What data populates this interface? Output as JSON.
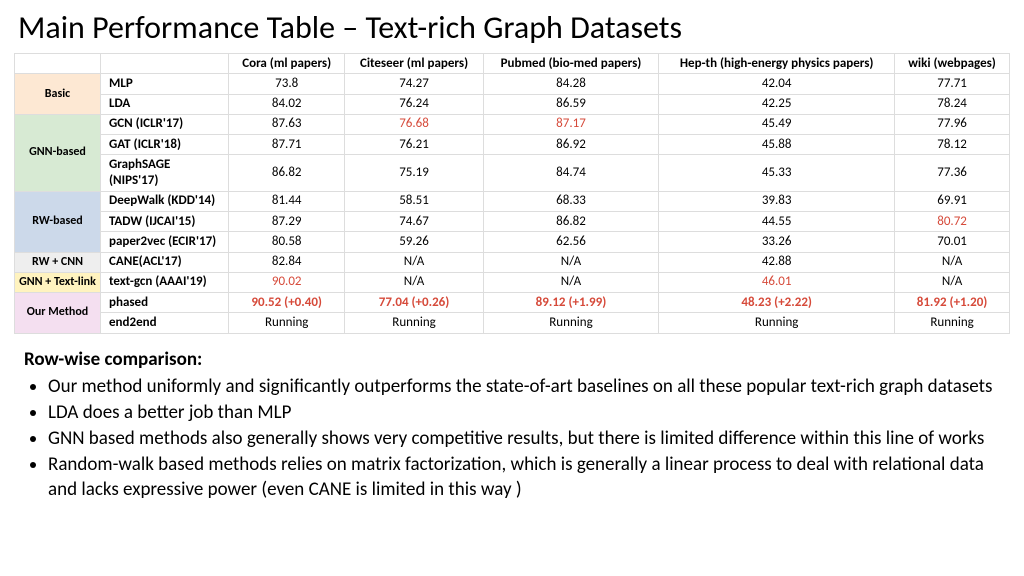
{
  "title": "Main Performance Table – Text-rich Graph Datasets",
  "columns": [
    "Cora (ml papers)",
    "Citeseer (ml papers)",
    "Pubmed (bio-med papers)",
    "Hep-th (high-energy physics papers)",
    "wiki (webpages)"
  ],
  "groups": [
    {
      "label": "Basic",
      "cls": "bg-basic",
      "rows": [
        {
          "method": "MLP",
          "cells": [
            {
              "v": "73.8"
            },
            {
              "v": "74.27"
            },
            {
              "v": "84.28"
            },
            {
              "v": "42.04"
            },
            {
              "v": "77.71"
            }
          ]
        },
        {
          "method": "LDA",
          "cells": [
            {
              "v": "84.02"
            },
            {
              "v": "76.24"
            },
            {
              "v": "86.59"
            },
            {
              "v": "42.25"
            },
            {
              "v": "78.24"
            }
          ]
        }
      ]
    },
    {
      "label": "GNN-based",
      "cls": "bg-gnn",
      "rows": [
        {
          "method": "GCN  (ICLR'17)",
          "cells": [
            {
              "v": "87.63"
            },
            {
              "v": "76.68",
              "hl": true
            },
            {
              "v": "87.17",
              "hl": true
            },
            {
              "v": "45.49"
            },
            {
              "v": "77.96"
            }
          ]
        },
        {
          "method": "GAT (ICLR'18)",
          "cells": [
            {
              "v": "87.71"
            },
            {
              "v": "76.21"
            },
            {
              "v": "86.92"
            },
            {
              "v": "45.88"
            },
            {
              "v": "78.12"
            }
          ]
        },
        {
          "method": "GraphSAGE (NIPS'17)",
          "cells": [
            {
              "v": "86.82"
            },
            {
              "v": "75.19"
            },
            {
              "v": "84.74"
            },
            {
              "v": "45.33"
            },
            {
              "v": "77.36"
            }
          ]
        }
      ]
    },
    {
      "label": "RW-based",
      "cls": "bg-rw",
      "rows": [
        {
          "method": "DeepWalk (KDD'14)",
          "cells": [
            {
              "v": "81.44"
            },
            {
              "v": "58.51"
            },
            {
              "v": "68.33"
            },
            {
              "v": "39.83"
            },
            {
              "v": "69.91"
            }
          ]
        },
        {
          "method": "TADW (IJCAI'15)",
          "cells": [
            {
              "v": "87.29"
            },
            {
              "v": "74.67"
            },
            {
              "v": "86.82"
            },
            {
              "v": "44.55"
            },
            {
              "v": "80.72",
              "hl": true
            }
          ]
        },
        {
          "method": "paper2vec (ECIR'17)",
          "cells": [
            {
              "v": "80.58"
            },
            {
              "v": "59.26"
            },
            {
              "v": "62.56"
            },
            {
              "v": "33.26"
            },
            {
              "v": "70.01"
            }
          ]
        }
      ]
    },
    {
      "label": "RW + CNN",
      "cls": "bg-rwcnn",
      "rows": [
        {
          "method": "CANE(ACL'17)",
          "cells": [
            {
              "v": "82.84"
            },
            {
              "v": "N/A"
            },
            {
              "v": "N/A"
            },
            {
              "v": "42.88"
            },
            {
              "v": "N/A"
            }
          ]
        }
      ]
    },
    {
      "label": "GNN + Text-link",
      "cls": "bg-gnnlink",
      "rows": [
        {
          "method": "text-gcn (AAAI'19)",
          "cells": [
            {
              "v": "90.02",
              "hl": true
            },
            {
              "v": "N/A"
            },
            {
              "v": "N/A"
            },
            {
              "v": "46.01",
              "hl": true
            },
            {
              "v": "N/A"
            }
          ]
        }
      ]
    },
    {
      "label": "Our Method",
      "cls": "bg-our",
      "rows": [
        {
          "method": "phased",
          "cells": [
            {
              "v": "90.52  (+0.40)",
              "hlb": true
            },
            {
              "v": "77.04 (+0.26)",
              "hlb": true
            },
            {
              "v": "89.12 (+1.99)",
              "hlb": true
            },
            {
              "v": "48.23 (+2.22)",
              "hlb": true
            },
            {
              "v": "81.92 (+1.20)",
              "hlb": true
            }
          ]
        },
        {
          "method": "end2end",
          "cells": [
            {
              "v": "Running"
            },
            {
              "v": "Running"
            },
            {
              "v": "Running"
            },
            {
              "v": "Running"
            },
            {
              "v": "Running"
            }
          ]
        }
      ]
    }
  ],
  "comparison": {
    "heading": "Row-wise comparison:",
    "bullets": [
      "Our method uniformly and significantly outperforms the state-of-art baselines on all these popular text-rich graph datasets",
      "LDA does a better job than MLP",
      "GNN based methods also generally shows very competitive results, but there is limited difference within this line of works",
      "Random-walk based methods relies on matrix factorization, which is generally a linear process to deal with relational data and lacks expressive power (even CANE is limited in this way )"
    ]
  },
  "chart_data": {
    "type": "table",
    "title": "Main Performance Table – Text-rich Graph Datasets",
    "columns": [
      "Cora (ml papers)",
      "Citeseer (ml papers)",
      "Pubmed (bio-med papers)",
      "Hep-th (high-energy physics papics papers)",
      "wiki (webpages)"
    ],
    "rows": [
      {
        "group": "Basic",
        "method": "MLP",
        "values": [
          73.8,
          74.27,
          84.28,
          42.04,
          77.71
        ]
      },
      {
        "group": "Basic",
        "method": "LDA",
        "values": [
          84.02,
          76.24,
          86.59,
          42.25,
          78.24
        ]
      },
      {
        "group": "GNN-based",
        "method": "GCN (ICLR'17)",
        "values": [
          87.63,
          76.68,
          87.17,
          45.49,
          77.96
        ]
      },
      {
        "group": "GNN-based",
        "method": "GAT (ICLR'18)",
        "values": [
          87.71,
          76.21,
          86.92,
          45.88,
          78.12
        ]
      },
      {
        "group": "GNN-based",
        "method": "GraphSAGE (NIPS'17)",
        "values": [
          86.82,
          75.19,
          84.74,
          45.33,
          77.36
        ]
      },
      {
        "group": "RW-based",
        "method": "DeepWalk (KDD'14)",
        "values": [
          81.44,
          58.51,
          68.33,
          39.83,
          69.91
        ]
      },
      {
        "group": "RW-based",
        "method": "TADW (IJCAI'15)",
        "values": [
          87.29,
          74.67,
          86.82,
          44.55,
          80.72
        ]
      },
      {
        "group": "RW-based",
        "method": "paper2vec (ECIR'17)",
        "values": [
          80.58,
          59.26,
          62.56,
          33.26,
          70.01
        ]
      },
      {
        "group": "RW + CNN",
        "method": "CANE (ACL'17)",
        "values": [
          82.84,
          null,
          null,
          42.88,
          null
        ]
      },
      {
        "group": "GNN + Text-link",
        "method": "text-gcn (AAAI'19)",
        "values": [
          90.02,
          null,
          null,
          46.01,
          null
        ]
      },
      {
        "group": "Our Method",
        "method": "phased",
        "values": [
          90.52,
          77.04,
          89.12,
          48.23,
          81.92
        ],
        "delta": [
          0.4,
          0.26,
          1.99,
          2.22,
          1.2
        ]
      },
      {
        "group": "Our Method",
        "method": "end2end",
        "values": [
          "Running",
          "Running",
          "Running",
          "Running",
          "Running"
        ]
      }
    ]
  }
}
